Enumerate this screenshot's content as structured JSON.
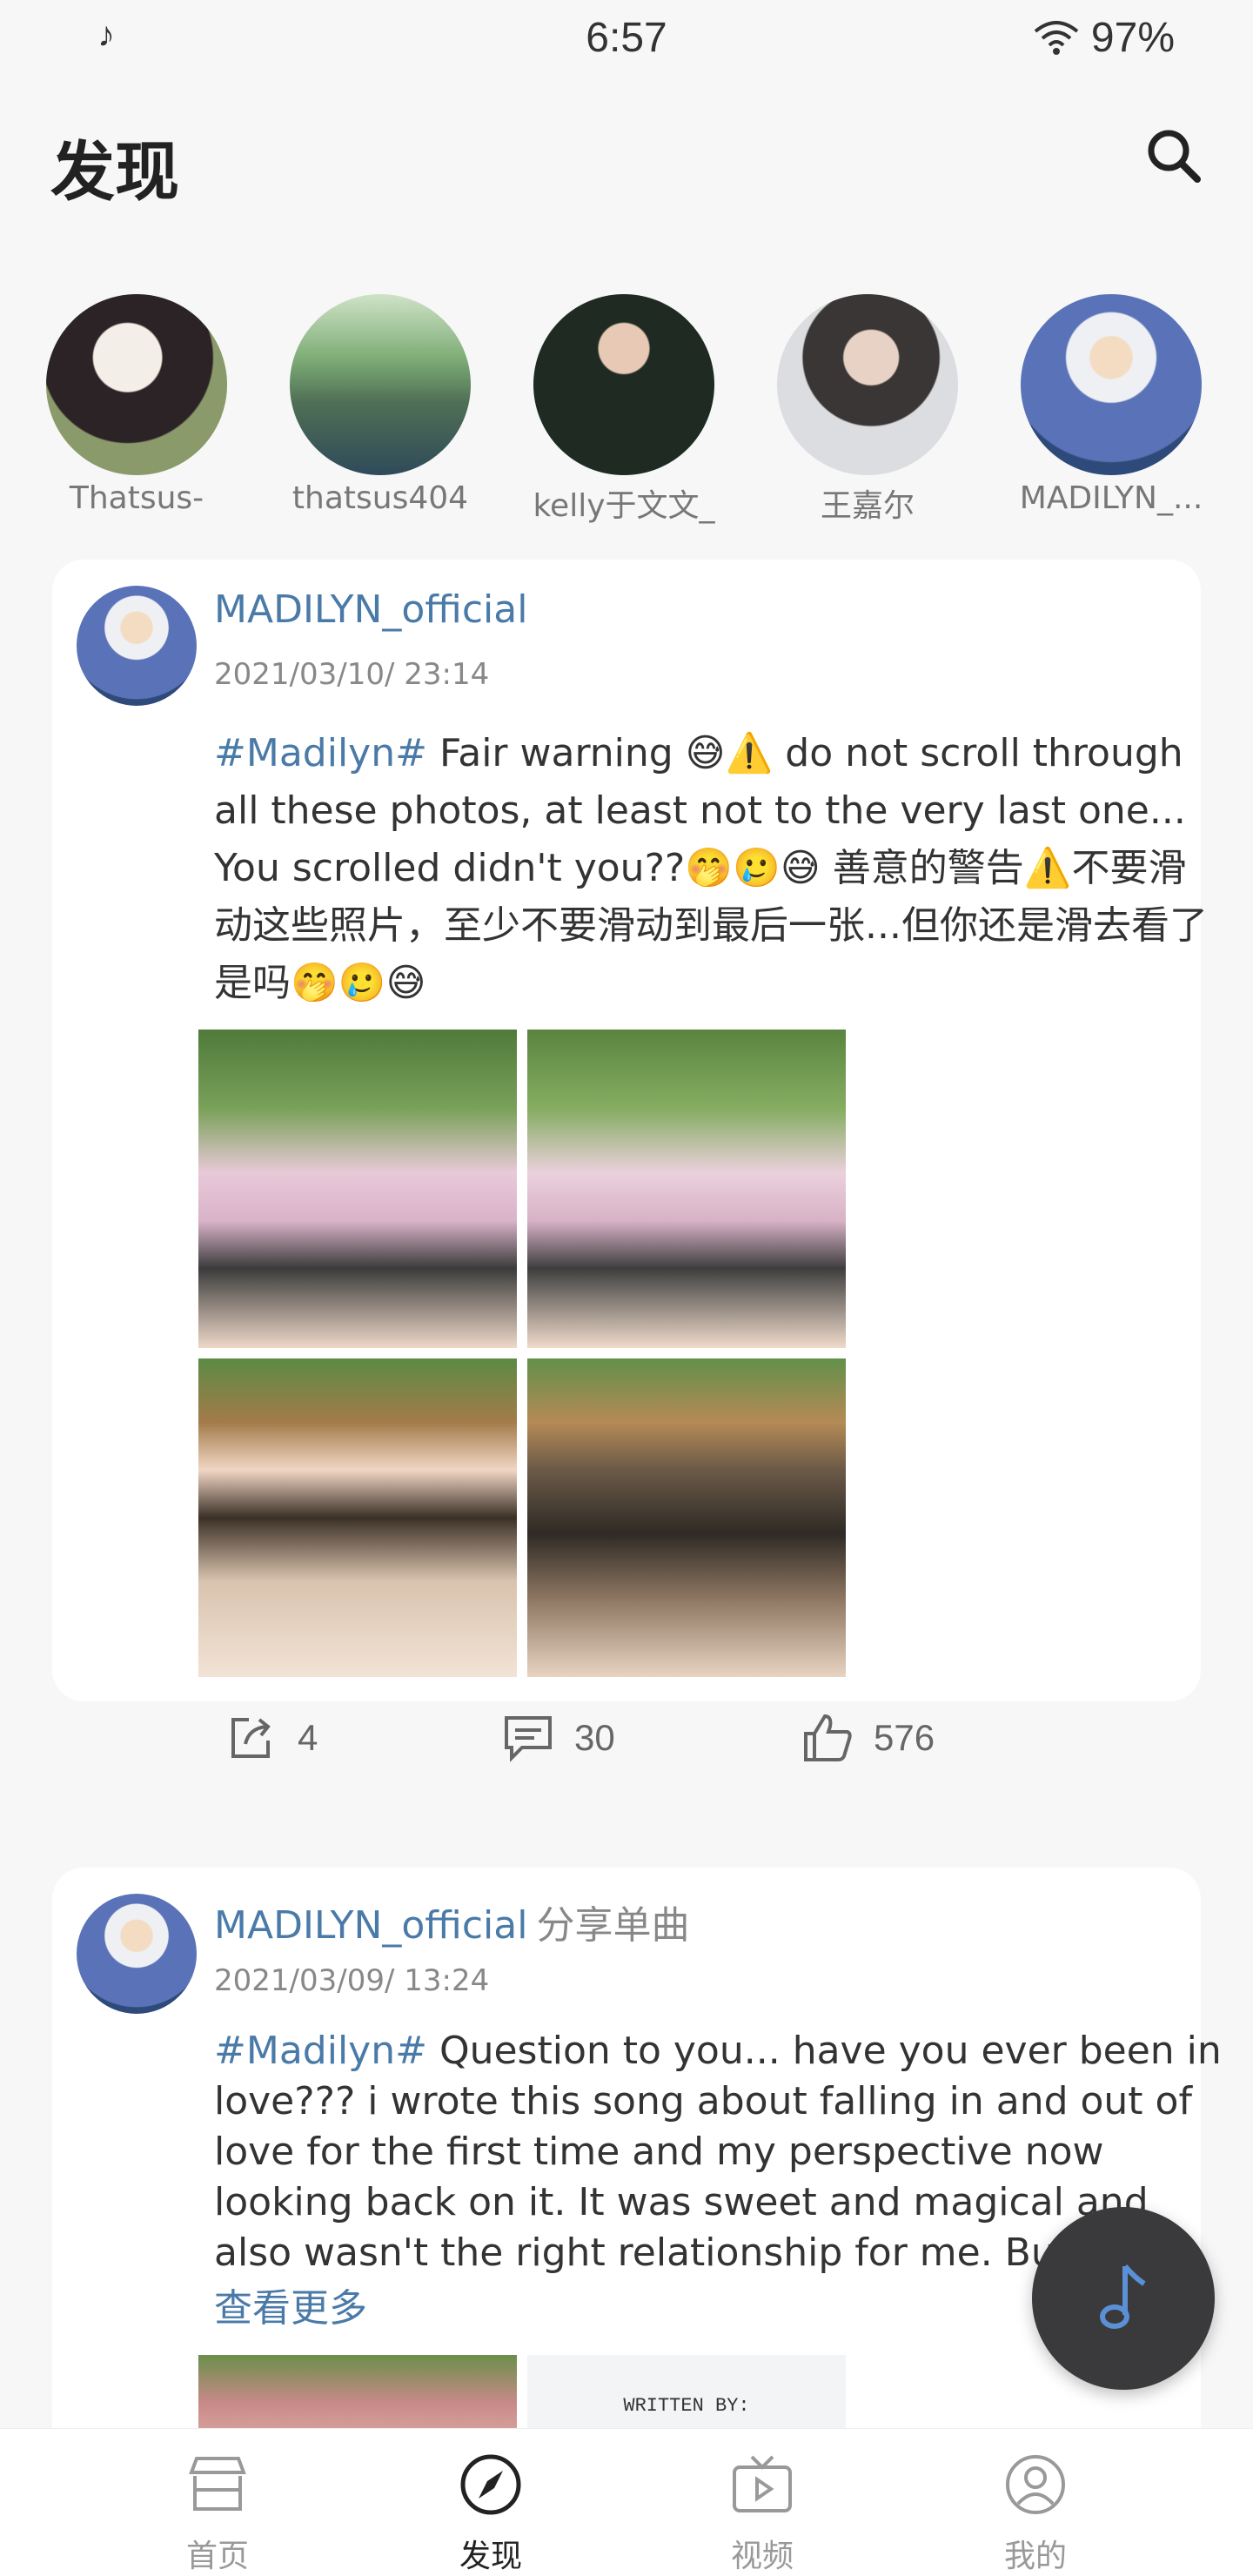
{
  "status_bar": {
    "music_icon": "music-note-icon",
    "time": "6:57",
    "wifi_icon": "wifi-icon",
    "battery": "97%"
  },
  "header": {
    "title": "发现",
    "search_icon": "search-icon"
  },
  "stories": [
    {
      "name": "Thatsus-"
    },
    {
      "name": "thatsus404"
    },
    {
      "name": "kelly于文文_"
    },
    {
      "name": "王嘉尔"
    },
    {
      "name": "MADILYN_..."
    }
  ],
  "posts": [
    {
      "author": "MADILYN_official",
      "share_tag": "",
      "time": "2021/03/10/ 23:14",
      "hashtag": "#Madilyn#",
      "text": " Fair warning 😅⚠️ do not scroll through all these photos, at least not to the very last one... You scrolled didn't you??🤭🥲😅 善意的警告⚠️不要滑动这些照片，至少不要滑动到最后一张...但你还是滑去看了是吗🤭🥲😅",
      "shares": "4",
      "comments": "30",
      "likes": "576"
    },
    {
      "author": "MADILYN_official",
      "share_tag": "分享单曲",
      "time": "2021/03/09/ 13:24",
      "hashtag": "#Madilyn#",
      "text": " Question to you... have you ever been in love??? i wrote this song about falling in and out of love for the first time and my perspective now looking back on it.  It was sweet and magical and also wasn't the right relationship for me.  But",
      "more": "查看更多",
      "image_text": "WRITTEN BY:"
    }
  ],
  "fab": {
    "icon": "music-note-icon"
  },
  "bottom_nav": [
    {
      "label": "首页",
      "icon": "store-icon",
      "active": false
    },
    {
      "label": "发现",
      "icon": "compass-icon",
      "active": true
    },
    {
      "label": "视频",
      "icon": "tv-play-icon",
      "active": false
    },
    {
      "label": "我的",
      "icon": "profile-icon",
      "active": false
    }
  ],
  "colors": {
    "accent_link": "#4a7aa8",
    "fab_bg": "#3a3a3c",
    "fab_note": "#5b8fd6"
  }
}
